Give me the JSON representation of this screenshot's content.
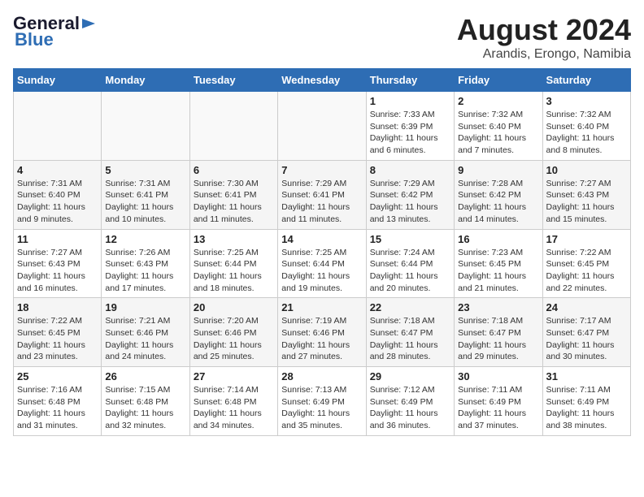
{
  "header": {
    "logo_general": "General",
    "logo_blue": "Blue",
    "title": "August 2024",
    "subtitle": "Arandis, Erongo, Namibia"
  },
  "days_of_week": [
    "Sunday",
    "Monday",
    "Tuesday",
    "Wednesday",
    "Thursday",
    "Friday",
    "Saturday"
  ],
  "weeks": [
    [
      {
        "num": "",
        "info": ""
      },
      {
        "num": "",
        "info": ""
      },
      {
        "num": "",
        "info": ""
      },
      {
        "num": "",
        "info": ""
      },
      {
        "num": "1",
        "info": "Sunrise: 7:33 AM\nSunset: 6:39 PM\nDaylight: 11 hours and 6 minutes."
      },
      {
        "num": "2",
        "info": "Sunrise: 7:32 AM\nSunset: 6:40 PM\nDaylight: 11 hours and 7 minutes."
      },
      {
        "num": "3",
        "info": "Sunrise: 7:32 AM\nSunset: 6:40 PM\nDaylight: 11 hours and 8 minutes."
      }
    ],
    [
      {
        "num": "4",
        "info": "Sunrise: 7:31 AM\nSunset: 6:40 PM\nDaylight: 11 hours and 9 minutes."
      },
      {
        "num": "5",
        "info": "Sunrise: 7:31 AM\nSunset: 6:41 PM\nDaylight: 11 hours and 10 minutes."
      },
      {
        "num": "6",
        "info": "Sunrise: 7:30 AM\nSunset: 6:41 PM\nDaylight: 11 hours and 11 minutes."
      },
      {
        "num": "7",
        "info": "Sunrise: 7:29 AM\nSunset: 6:41 PM\nDaylight: 11 hours and 11 minutes."
      },
      {
        "num": "8",
        "info": "Sunrise: 7:29 AM\nSunset: 6:42 PM\nDaylight: 11 hours and 13 minutes."
      },
      {
        "num": "9",
        "info": "Sunrise: 7:28 AM\nSunset: 6:42 PM\nDaylight: 11 hours and 14 minutes."
      },
      {
        "num": "10",
        "info": "Sunrise: 7:27 AM\nSunset: 6:43 PM\nDaylight: 11 hours and 15 minutes."
      }
    ],
    [
      {
        "num": "11",
        "info": "Sunrise: 7:27 AM\nSunset: 6:43 PM\nDaylight: 11 hours and 16 minutes."
      },
      {
        "num": "12",
        "info": "Sunrise: 7:26 AM\nSunset: 6:43 PM\nDaylight: 11 hours and 17 minutes."
      },
      {
        "num": "13",
        "info": "Sunrise: 7:25 AM\nSunset: 6:44 PM\nDaylight: 11 hours and 18 minutes."
      },
      {
        "num": "14",
        "info": "Sunrise: 7:25 AM\nSunset: 6:44 PM\nDaylight: 11 hours and 19 minutes."
      },
      {
        "num": "15",
        "info": "Sunrise: 7:24 AM\nSunset: 6:44 PM\nDaylight: 11 hours and 20 minutes."
      },
      {
        "num": "16",
        "info": "Sunrise: 7:23 AM\nSunset: 6:45 PM\nDaylight: 11 hours and 21 minutes."
      },
      {
        "num": "17",
        "info": "Sunrise: 7:22 AM\nSunset: 6:45 PM\nDaylight: 11 hours and 22 minutes."
      }
    ],
    [
      {
        "num": "18",
        "info": "Sunrise: 7:22 AM\nSunset: 6:45 PM\nDaylight: 11 hours and 23 minutes."
      },
      {
        "num": "19",
        "info": "Sunrise: 7:21 AM\nSunset: 6:46 PM\nDaylight: 11 hours and 24 minutes."
      },
      {
        "num": "20",
        "info": "Sunrise: 7:20 AM\nSunset: 6:46 PM\nDaylight: 11 hours and 25 minutes."
      },
      {
        "num": "21",
        "info": "Sunrise: 7:19 AM\nSunset: 6:46 PM\nDaylight: 11 hours and 27 minutes."
      },
      {
        "num": "22",
        "info": "Sunrise: 7:18 AM\nSunset: 6:47 PM\nDaylight: 11 hours and 28 minutes."
      },
      {
        "num": "23",
        "info": "Sunrise: 7:18 AM\nSunset: 6:47 PM\nDaylight: 11 hours and 29 minutes."
      },
      {
        "num": "24",
        "info": "Sunrise: 7:17 AM\nSunset: 6:47 PM\nDaylight: 11 hours and 30 minutes."
      }
    ],
    [
      {
        "num": "25",
        "info": "Sunrise: 7:16 AM\nSunset: 6:48 PM\nDaylight: 11 hours and 31 minutes."
      },
      {
        "num": "26",
        "info": "Sunrise: 7:15 AM\nSunset: 6:48 PM\nDaylight: 11 hours and 32 minutes."
      },
      {
        "num": "27",
        "info": "Sunrise: 7:14 AM\nSunset: 6:48 PM\nDaylight: 11 hours and 34 minutes."
      },
      {
        "num": "28",
        "info": "Sunrise: 7:13 AM\nSunset: 6:49 PM\nDaylight: 11 hours and 35 minutes."
      },
      {
        "num": "29",
        "info": "Sunrise: 7:12 AM\nSunset: 6:49 PM\nDaylight: 11 hours and 36 minutes."
      },
      {
        "num": "30",
        "info": "Sunrise: 7:11 AM\nSunset: 6:49 PM\nDaylight: 11 hours and 37 minutes."
      },
      {
        "num": "31",
        "info": "Sunrise: 7:11 AM\nSunset: 6:49 PM\nDaylight: 11 hours and 38 minutes."
      }
    ]
  ]
}
